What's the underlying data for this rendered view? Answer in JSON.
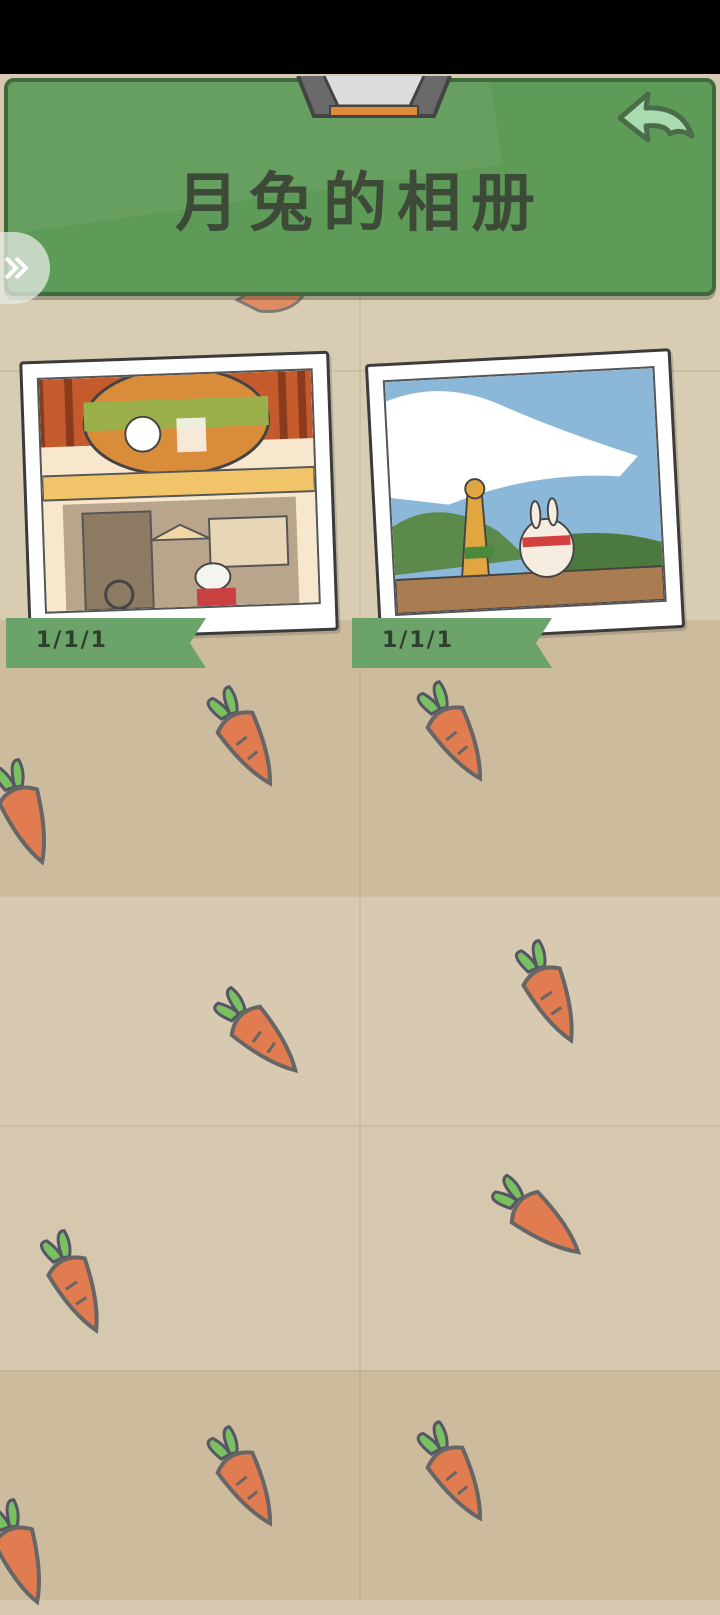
{
  "header": {
    "title": "月兔的相册"
  },
  "icons": {
    "back": "back-arrow-icon",
    "side_tab": "chevron-right-icon",
    "decoration": "carrot-icon"
  },
  "photos": [
    {
      "date": "1/1/1",
      "scene": "shop-with-bunny"
    },
    {
      "date": "1/1/1",
      "scene": "giraffe-and-bunny-on-bridge"
    }
  ],
  "colors": {
    "header_green": "#5e9a58",
    "background": "#d6c9b0",
    "ribbon_green": "#6ba36a"
  }
}
